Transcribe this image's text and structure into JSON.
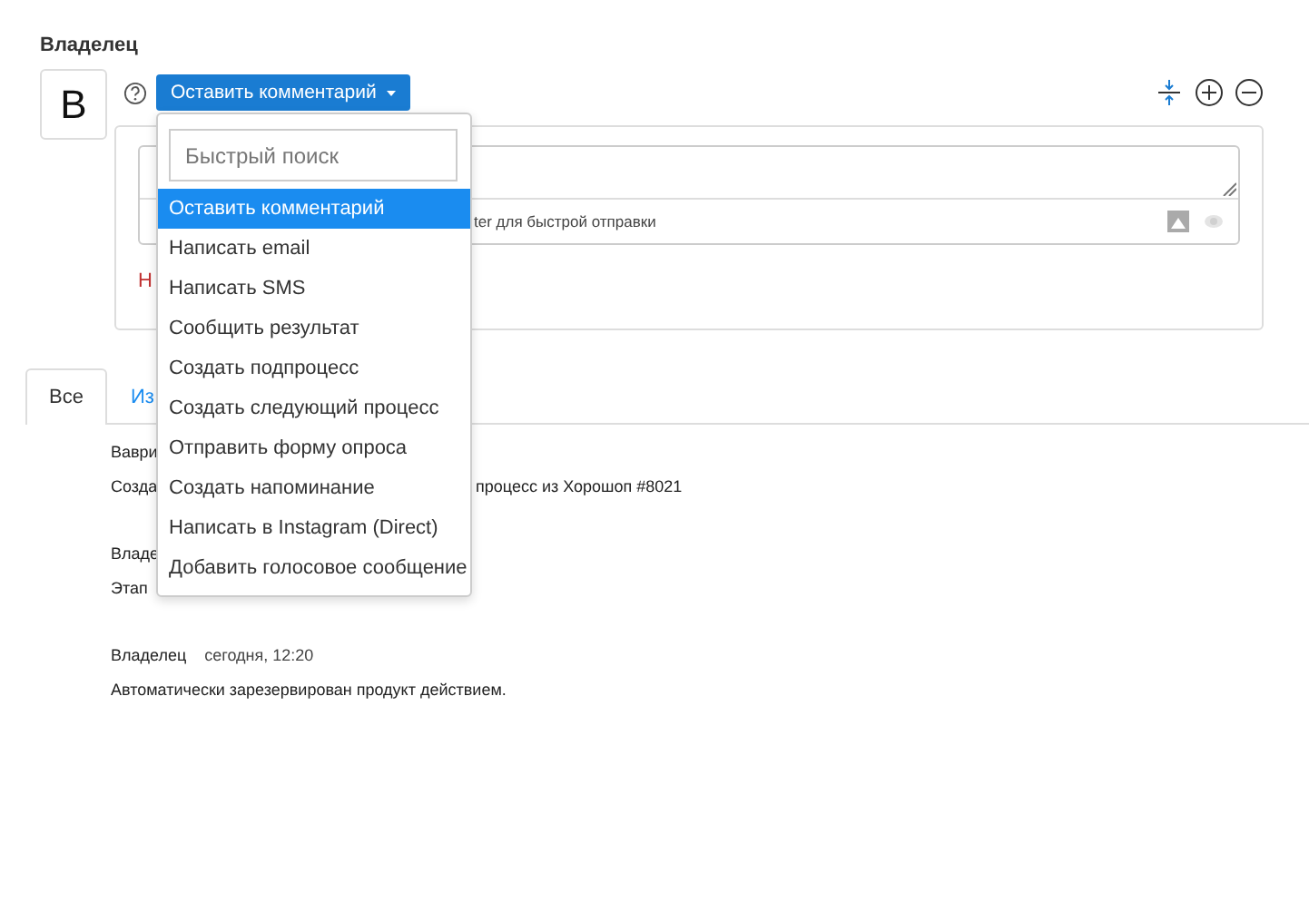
{
  "owner_label": "Владелец",
  "avatar_letter": "В",
  "action_button": {
    "label": "Оставить комментарий"
  },
  "comment_box": {
    "hint": "ter для быстрой отправки",
    "error": "Н"
  },
  "dropdown": {
    "search_placeholder": "Быстрый поиск",
    "items": [
      {
        "label": "Оставить комментарий",
        "selected": true
      },
      {
        "label": "Написать email",
        "selected": false
      },
      {
        "label": "Написать SMS",
        "selected": false
      },
      {
        "label": "Сообщить результат",
        "selected": false
      },
      {
        "label": "Создать подпроцесс",
        "selected": false
      },
      {
        "label": "Создать следующий процесс",
        "selected": false
      },
      {
        "label": "Отправить форму опроса",
        "selected": false
      },
      {
        "label": "Создать напоминание",
        "selected": false
      },
      {
        "label": "Написать в Instagram (Direct)",
        "selected": false
      },
      {
        "label": "Добавить голосовое сообщение",
        "selected": false
      }
    ]
  },
  "tabs": [
    {
      "label": "Все",
      "selected": true
    },
    {
      "label": "Из",
      "selected": false
    }
  ],
  "activity": [
    {
      "author": "Ваври",
      "text_left": "Созда",
      "text_right": "процесс из Хорошоп #8021"
    },
    {
      "author": "Владе",
      "text_left": "Этап"
    },
    {
      "author": "Владелец",
      "time": "сегодня, 12:20",
      "text_left": "Автоматически зарезервирован продукт действием."
    }
  ]
}
